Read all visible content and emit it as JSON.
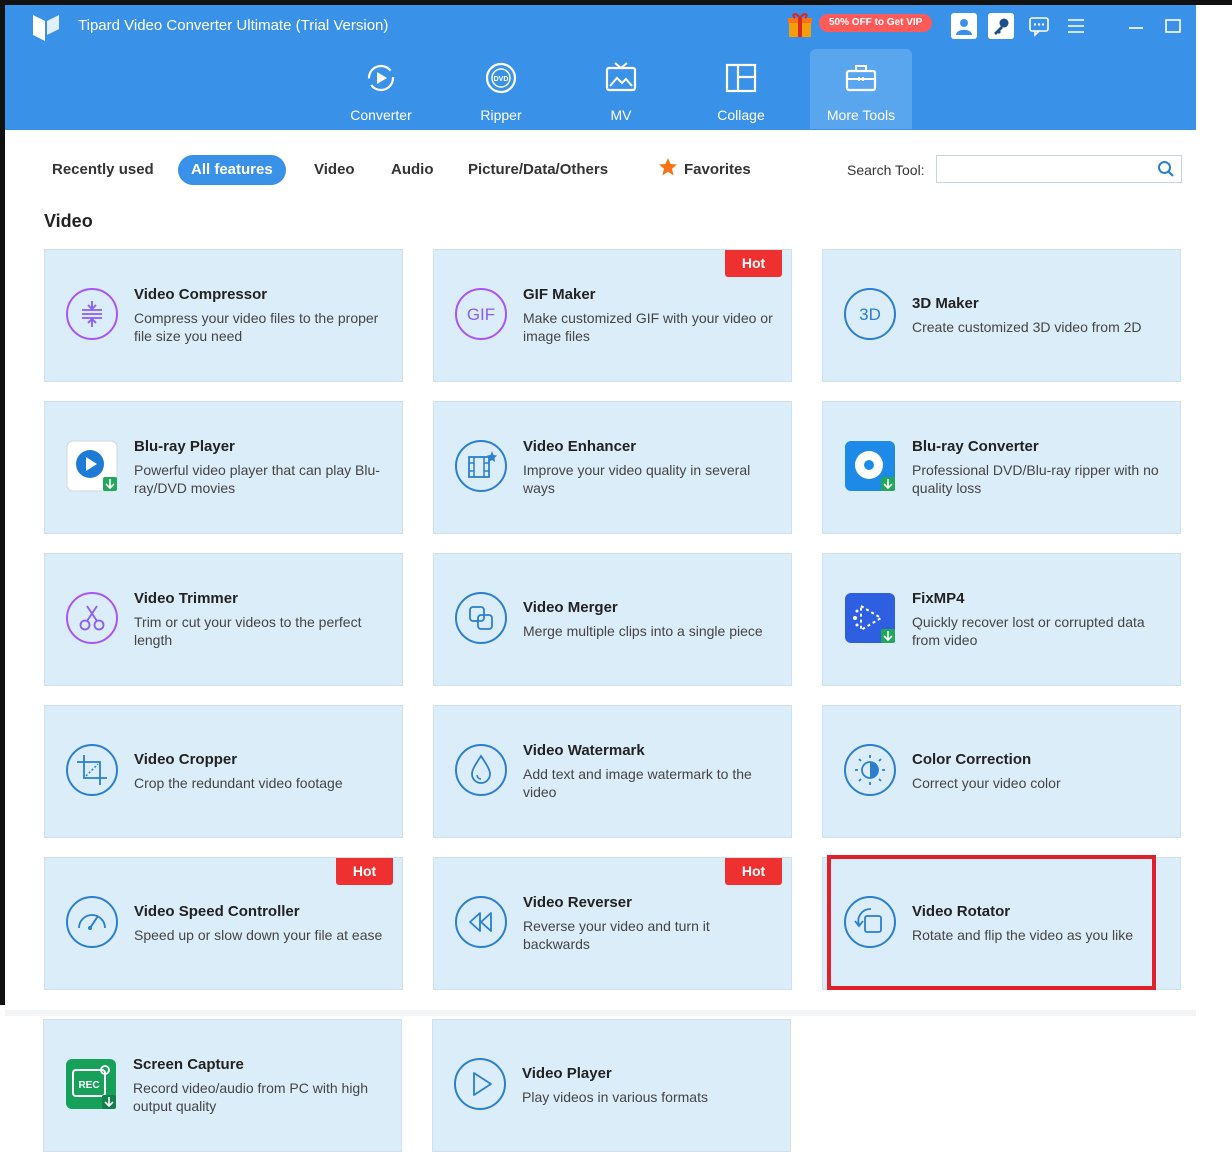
{
  "app": {
    "title": "Tipard Video Converter Ultimate (Trial Version)",
    "promo": "50% OFF to Get VIP"
  },
  "nav": {
    "tabs": [
      {
        "label": "Converter",
        "icon": "converter-icon"
      },
      {
        "label": "Ripper",
        "icon": "dvd-icon"
      },
      {
        "label": "MV",
        "icon": "mv-icon"
      },
      {
        "label": "Collage",
        "icon": "collage-icon"
      },
      {
        "label": "More Tools",
        "icon": "toolbox-icon",
        "active": true
      }
    ]
  },
  "filters": {
    "items": [
      "Recently used",
      "All features",
      "Video",
      "Audio",
      "Picture/Data/Others",
      "Favorites"
    ],
    "active": "All features",
    "search_label": "Search Tool:",
    "search_value": ""
  },
  "section": {
    "title": "Video"
  },
  "tools": [
    {
      "name": "Video Compressor",
      "desc": "Compress your video files to the proper file size you need",
      "icon": "compress-icon"
    },
    {
      "name": "GIF Maker",
      "desc": "Make customized GIF with your video or image files",
      "icon": "gif-icon",
      "badge": "Hot"
    },
    {
      "name": "3D Maker",
      "desc": "Create customized 3D video from 2D",
      "icon": "3d-icon"
    },
    {
      "name": "Blu-ray Player",
      "desc": "Powerful video player that can play Blu-ray/DVD movies",
      "icon": "bluray-player-icon"
    },
    {
      "name": "Video Enhancer",
      "desc": "Improve your video quality in several ways",
      "icon": "enhancer-icon"
    },
    {
      "name": "Blu-ray Converter",
      "desc": "Professional DVD/Blu-ray ripper with no quality loss",
      "icon": "bluray-converter-icon"
    },
    {
      "name": "Video Trimmer",
      "desc": "Trim or cut your videos to the perfect length",
      "icon": "scissors-icon"
    },
    {
      "name": "Video Merger",
      "desc": "Merge multiple clips into a single piece",
      "icon": "merge-icon"
    },
    {
      "name": "FixMP4",
      "desc": "Quickly recover lost or corrupted data from video",
      "icon": "fixmp4-icon"
    },
    {
      "name": "Video Cropper",
      "desc": "Crop the redundant video footage",
      "icon": "crop-icon"
    },
    {
      "name": "Video Watermark",
      "desc": "Add text and image watermark to the video",
      "icon": "watermark-icon"
    },
    {
      "name": "Color Correction",
      "desc": "Correct your video color",
      "icon": "color-correction-icon"
    },
    {
      "name": "Video Speed Controller",
      "desc": "Speed up or slow down your file at ease",
      "icon": "speed-icon",
      "badge": "Hot"
    },
    {
      "name": "Video Reverser",
      "desc": "Reverse your video and turn it backwards",
      "icon": "reverse-icon",
      "badge": "Hot"
    },
    {
      "name": "Video Rotator",
      "desc": "Rotate and flip the video as you like",
      "icon": "rotate-icon"
    },
    {
      "name": "Screen Capture",
      "desc": "Record video/audio from PC with high output quality",
      "icon": "screen-capture-icon"
    },
    {
      "name": "Video Player",
      "desc": "Play videos in various formats",
      "icon": "play-icon"
    }
  ],
  "colors": {
    "header": "#3a92e8",
    "card": "#dcedfa",
    "accent": "#3a92e8",
    "hot": "#ee3030",
    "highlight": "#e0202a",
    "icon_stroke": "#2a7fcf"
  }
}
